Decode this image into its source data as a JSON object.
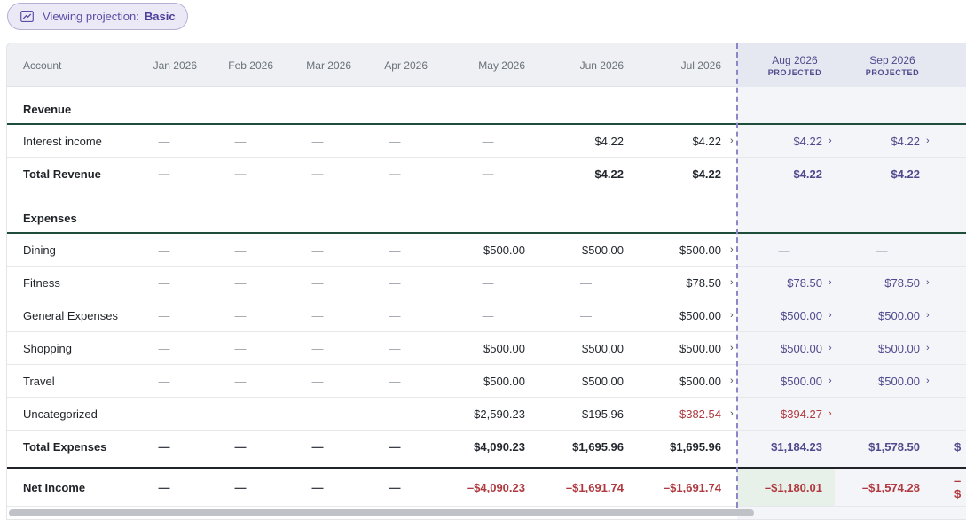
{
  "projection_pill": {
    "icon": "trend-line-icon",
    "label": "Viewing projection:",
    "value": "Basic"
  },
  "header": {
    "account": "Account",
    "months": [
      "Jan 2026",
      "Feb 2026",
      "Mar 2026",
      "Apr 2026",
      "May 2026",
      "Jun 2026",
      "Jul 2026"
    ],
    "projected": [
      {
        "month": "Aug 2026",
        "tag": "PROJECTED"
      },
      {
        "month": "Sep 2026",
        "tag": "PROJECTED"
      }
    ]
  },
  "sections": {
    "revenue": "Revenue",
    "expenses": "Expenses"
  },
  "dash": "—",
  "rows": {
    "interest": {
      "name": "Interest income",
      "values": [
        "—",
        "—",
        "—",
        "—",
        "—",
        "$4.22",
        "$4.22"
      ],
      "projected": [
        "$4.22",
        "$4.22"
      ]
    },
    "total_revenue": {
      "name": "Total Revenue",
      "values": [
        "—",
        "—",
        "—",
        "—",
        "—",
        "$4.22",
        "$4.22"
      ],
      "projected": [
        "$4.22",
        "$4.22"
      ]
    },
    "dining": {
      "name": "Dining",
      "values": [
        "—",
        "—",
        "—",
        "—",
        "$500.00",
        "$500.00",
        "$500.00"
      ],
      "projected": [
        "—",
        "—"
      ]
    },
    "fitness": {
      "name": "Fitness",
      "values": [
        "—",
        "—",
        "—",
        "—",
        "—",
        "—",
        "$78.50"
      ],
      "projected": [
        "$78.50",
        "$78.50"
      ]
    },
    "general": {
      "name": "General Expenses",
      "values": [
        "—",
        "—",
        "—",
        "—",
        "—",
        "—",
        "$500.00"
      ],
      "projected": [
        "$500.00",
        "$500.00"
      ]
    },
    "shopping": {
      "name": "Shopping",
      "values": [
        "—",
        "—",
        "—",
        "—",
        "$500.00",
        "$500.00",
        "$500.00"
      ],
      "projected": [
        "$500.00",
        "$500.00"
      ]
    },
    "travel": {
      "name": "Travel",
      "values": [
        "—",
        "—",
        "—",
        "—",
        "$500.00",
        "$500.00",
        "$500.00"
      ],
      "projected": [
        "$500.00",
        "$500.00"
      ]
    },
    "uncategorized": {
      "name": "Uncategorized",
      "values": [
        "—",
        "—",
        "—",
        "—",
        "$2,590.23",
        "$195.96",
        "–$382.54"
      ],
      "projected": [
        "–$394.27",
        "—"
      ]
    },
    "total_expenses": {
      "name": "Total Expenses",
      "values": [
        "—",
        "—",
        "—",
        "—",
        "$4,090.23",
        "$1,695.96",
        "$1,695.96"
      ],
      "projected": [
        "$1,184.23",
        "$1,578.50"
      ],
      "clipped": "$"
    },
    "net_income": {
      "name": "Net Income",
      "values": [
        "—",
        "—",
        "—",
        "—",
        "–$4,090.23",
        "–$1,691.74",
        "–$1,691.74"
      ],
      "projected": [
        "–$1,180.01",
        "–$1,574.28"
      ],
      "clipped": "–$"
    }
  },
  "colors": {
    "accent": "#4f4a8d",
    "negative": "#b0393f",
    "section_rule": "#1e4d3b",
    "pill_bg": "#ebe9f6"
  }
}
